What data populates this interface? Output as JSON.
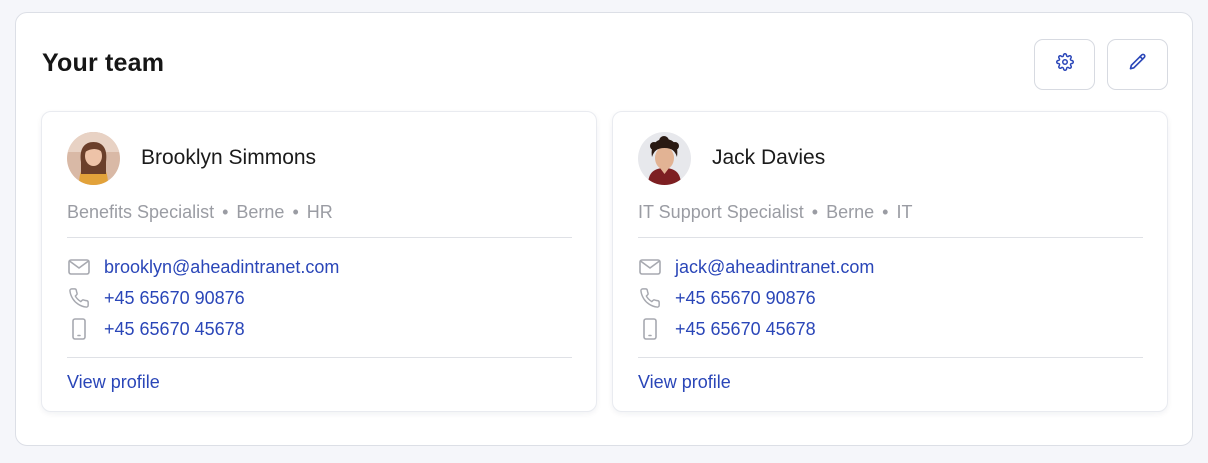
{
  "widget": {
    "title": "Your team",
    "actions": [
      {
        "icon": "gear-icon",
        "label": ""
      },
      {
        "icon": "pencil-icon",
        "label": ""
      }
    ]
  },
  "team": [
    {
      "name": "Brooklyn Simmons",
      "role": "Benefits Specialist",
      "location": "Berne",
      "department": "HR",
      "email": "brooklyn@aheadintranet.com",
      "phone": "+45 65670 90876",
      "mobile": "+45 65670 45678",
      "view_profile": "View profile"
    },
    {
      "name": "Jack Davies",
      "role": "IT Support Specialist",
      "location": "Berne",
      "department": "IT",
      "email": "jack@aheadintranet.com",
      "phone": "+45 65670 90876",
      "mobile": "+45 65670 45678",
      "view_profile": "View profile"
    }
  ],
  "separator": "•",
  "colors": {
    "accent": "#2a46b8",
    "muted_text": "#9a9ca3",
    "icon_gray": "#a7a9b0"
  }
}
